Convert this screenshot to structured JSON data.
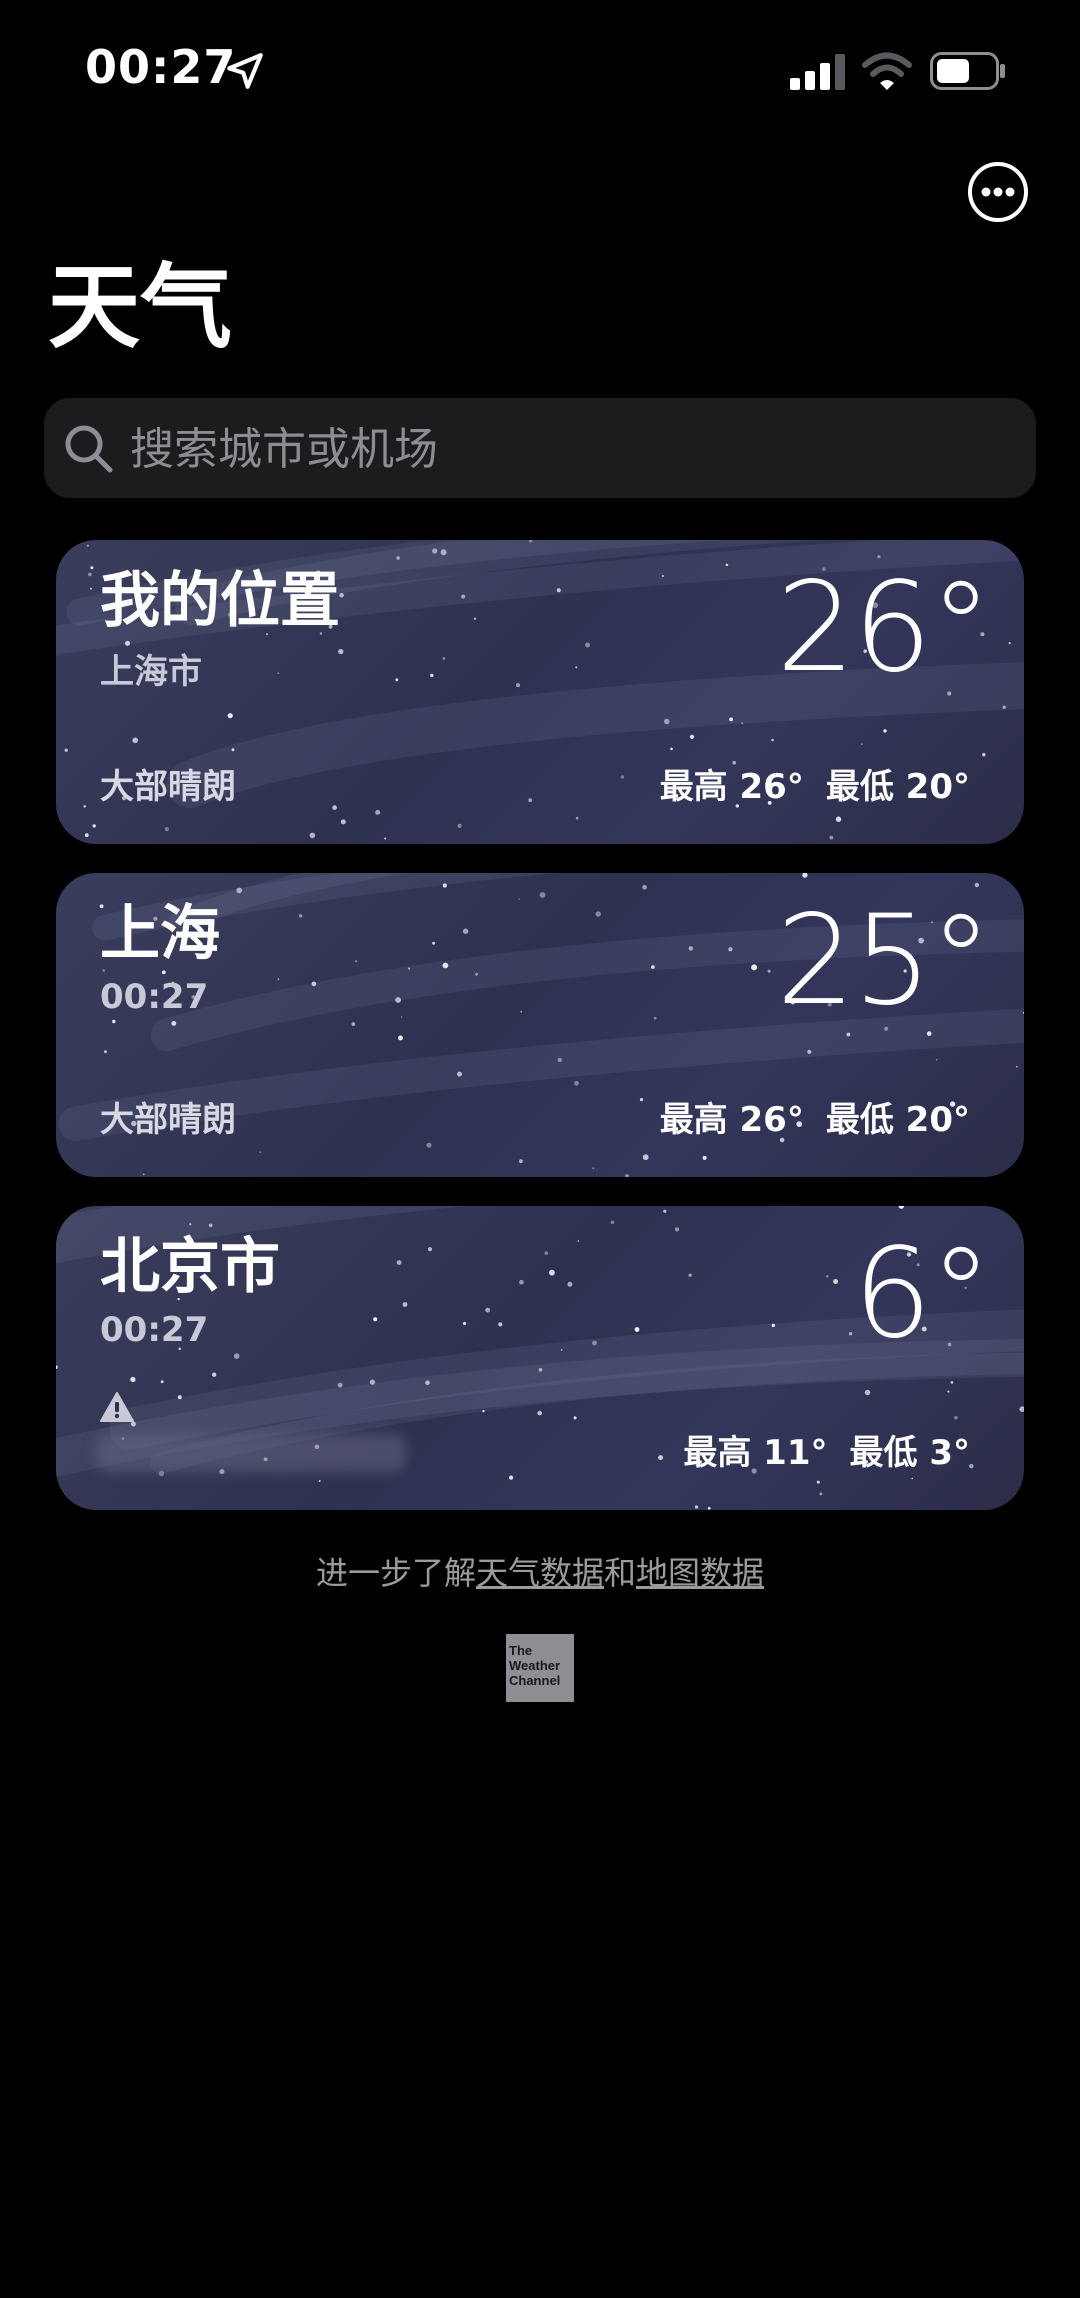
{
  "status_bar": {
    "time": "00:27"
  },
  "header": {
    "title": "天气"
  },
  "search": {
    "placeholder": "搜索城市或机场"
  },
  "cities": [
    {
      "title": "我的位置",
      "subtitle": "上海市",
      "temperature": "26°",
      "condition": "大部晴朗",
      "high": "最高 26°",
      "low": "最低 20°"
    },
    {
      "title": "上海",
      "subtitle": "00:27",
      "temperature": "25°",
      "condition": "大部晴朗",
      "high": "最高 26°",
      "low": "最低 20°"
    },
    {
      "title": "北京市",
      "subtitle": "00:27",
      "temperature": "6°",
      "condition": "",
      "high": "最高 11°",
      "low": "最低 3°"
    }
  ],
  "footer": {
    "prefix": "进一步了解",
    "link_weather": "天气数据",
    "connector": "和",
    "link_map": "地图数据",
    "logo_line1": "The",
    "logo_line2": "Weather",
    "logo_line3": "Channel"
  },
  "colors": {
    "background": "#000000",
    "search_bg": "#1c1c1e",
    "card_bg": "#2f3252",
    "secondary_text": "#9a9a9f"
  },
  "icons": [
    "location-arrow-icon",
    "signal-icon",
    "wifi-icon",
    "battery-icon",
    "more-icon",
    "search-icon",
    "warning-icon"
  ]
}
